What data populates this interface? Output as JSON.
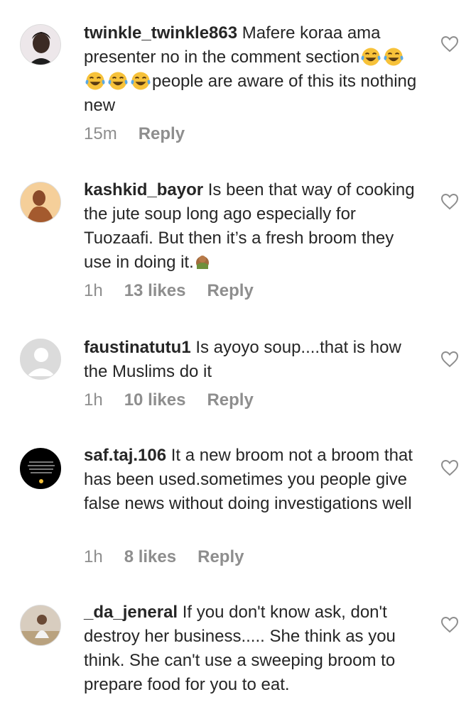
{
  "colors": {
    "text": "#262626",
    "meta": "#8e8e8e",
    "avatar_placeholder": "#dbdbdb",
    "emoji_yellow": "#f7c23a"
  },
  "icons": {
    "like": "heart-outline-icon",
    "emoji_joy": "face-with-tears-of-joy-emoji",
    "emoji_see_no_evil": "hands-covering-face-emoji"
  },
  "comments": [
    {
      "username": "twinkle_twinkle863",
      "text_before_emoji": " Mafere koraa ama presenter no in the comment section",
      "emoji_count": 5,
      "text_after_emoji": "people are aware of this its nothing new",
      "time": "15m",
      "likes": "",
      "reply": "Reply"
    },
    {
      "username": "kashkid_bayor",
      "text": " Is been that way of cooking the jute soup long ago especially for Tuozaafi. But then it’s a fresh broom they use in doing it.",
      "time": "1h",
      "likes": "13 likes",
      "reply": "Reply"
    },
    {
      "username": "faustinatutu1",
      "text": " Is ayoyo soup....that is how the Muslims do it",
      "time": "1h",
      "likes": "10 likes",
      "reply": "Reply"
    },
    {
      "username": "saf.taj.106",
      "text": " It a new broom not a broom that has been used.sometimes you people give false news without doing investigations well",
      "time": "1h",
      "likes": "8 likes",
      "reply": "Reply"
    },
    {
      "username": "_da_jeneral",
      "text": " If you don't know ask, don't destroy her business..... She think as you think. She can't use a sweeping broom to prepare food for you to eat."
    }
  ]
}
